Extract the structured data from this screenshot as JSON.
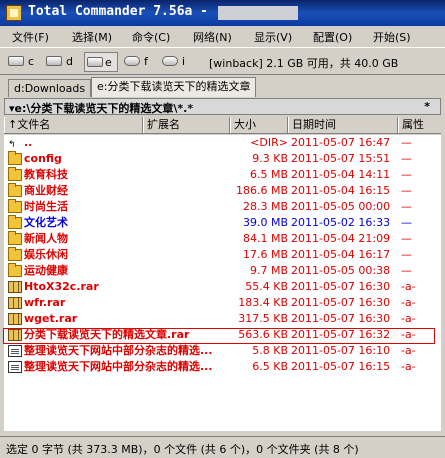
{
  "window": {
    "title": "Total Commander 7.56a -"
  },
  "menu": [
    "文件(F)",
    "选择(M)",
    "命令(C)",
    "网络(N)",
    "显示(V)",
    "配置(O)",
    "开始(S)"
  ],
  "drives": [
    {
      "letter": "c",
      "active": false
    },
    {
      "letter": "d",
      "active": false
    },
    {
      "letter": "e",
      "active": true
    },
    {
      "letter": "f",
      "active": false
    },
    {
      "letter": "i",
      "active": false
    }
  ],
  "disk_info": "[winback]  2.1 GB 可用，共 40.0 GB",
  "tabs": [
    {
      "label": "d:Downloads",
      "active": false
    },
    {
      "label": "e:分类下载读览天下的精选文章",
      "active": true
    }
  ],
  "path": "▾e:\\分类下载读览天下的精选文章\\*.*",
  "filter": "*",
  "columns": {
    "name": "↑文件名",
    "ext": "扩展名",
    "size": "大小",
    "date": "日期时间",
    "attr": "属性"
  },
  "rows": [
    {
      "icon": "up-icon",
      "name": "..",
      "ext": "",
      "size": "<DIR>",
      "date": "2011-05-07 16:47",
      "attr": "—",
      "color": "red"
    },
    {
      "icon": "folder-icon",
      "name": "config",
      "ext": "",
      "size": "9.3 KB",
      "date": "2011-05-07 15:51",
      "attr": "—",
      "color": "red"
    },
    {
      "icon": "folder-icon",
      "name": "教育科技",
      "ext": "",
      "size": "6.5 MB",
      "date": "2011-05-04 14:11",
      "attr": "—",
      "color": "red"
    },
    {
      "icon": "folder-icon",
      "name": "商业财经",
      "ext": "",
      "size": "186.6 MB",
      "date": "2011-05-04 16:15",
      "attr": "—",
      "color": "red"
    },
    {
      "icon": "folder-icon",
      "name": "时尚生活",
      "ext": "",
      "size": "28.3 MB",
      "date": "2011-05-05 00:00",
      "attr": "—",
      "color": "red"
    },
    {
      "icon": "folder-icon",
      "name": "文化艺术",
      "ext": "",
      "size": "39.0 MB",
      "date": "2011-05-02 16:33",
      "attr": "—",
      "color": "blue"
    },
    {
      "icon": "folder-icon",
      "name": "新闻人物",
      "ext": "",
      "size": "84.1 MB",
      "date": "2011-05-04 21:09",
      "attr": "—",
      "color": "red"
    },
    {
      "icon": "folder-icon",
      "name": "娱乐休闲",
      "ext": "",
      "size": "17.6 MB",
      "date": "2011-05-04 16:17",
      "attr": "—",
      "color": "red"
    },
    {
      "icon": "folder-icon",
      "name": "运动健康",
      "ext": "",
      "size": "9.7 MB",
      "date": "2011-05-05 00:38",
      "attr": "—",
      "color": "red"
    },
    {
      "icon": "archive-icon",
      "name": "HtoX32c.rar",
      "ext": "",
      "size": "55.4 KB",
      "date": "2011-05-07 16:30",
      "attr": "-a-",
      "color": "red"
    },
    {
      "icon": "archive-icon",
      "name": "wfr.rar",
      "ext": "",
      "size": "183.4 KB",
      "date": "2011-05-07 16:30",
      "attr": "-a-",
      "color": "red"
    },
    {
      "icon": "archive-icon",
      "name": "wget.rar",
      "ext": "",
      "size": "317.5 KB",
      "date": "2011-05-07 16:30",
      "attr": "-a-",
      "color": "red"
    },
    {
      "icon": "archive-icon",
      "name": "分类下载读览天下的精选文章.rar",
      "ext": "",
      "size": "563.6 KB",
      "date": "2011-05-07 16:32",
      "attr": "-a-",
      "color": "red",
      "selected": true
    },
    {
      "icon": "exe-icon",
      "name": "整理读览天下网站中部分杂志的精选...",
      "ext": "",
      "size": "5.8 KB",
      "date": "2011-05-07 16:10",
      "attr": "-a-",
      "color": "red"
    },
    {
      "icon": "document-icon",
      "name": "整理读览天下网站中部分杂志的精选...",
      "ext": "",
      "size": "6.5 KB",
      "date": "2011-05-07 16:15",
      "attr": "-a-",
      "color": "red"
    }
  ],
  "status": "选定 0 字节 (共 373.3 MB)，0 个文件 (共 6 个)，0 个文件夹 (共 8 个)",
  "colors": {
    "title_bar": "#0a246a",
    "file_red": "#e00000",
    "file_blue": "#0000e0",
    "selection_frame": "#e00000"
  }
}
